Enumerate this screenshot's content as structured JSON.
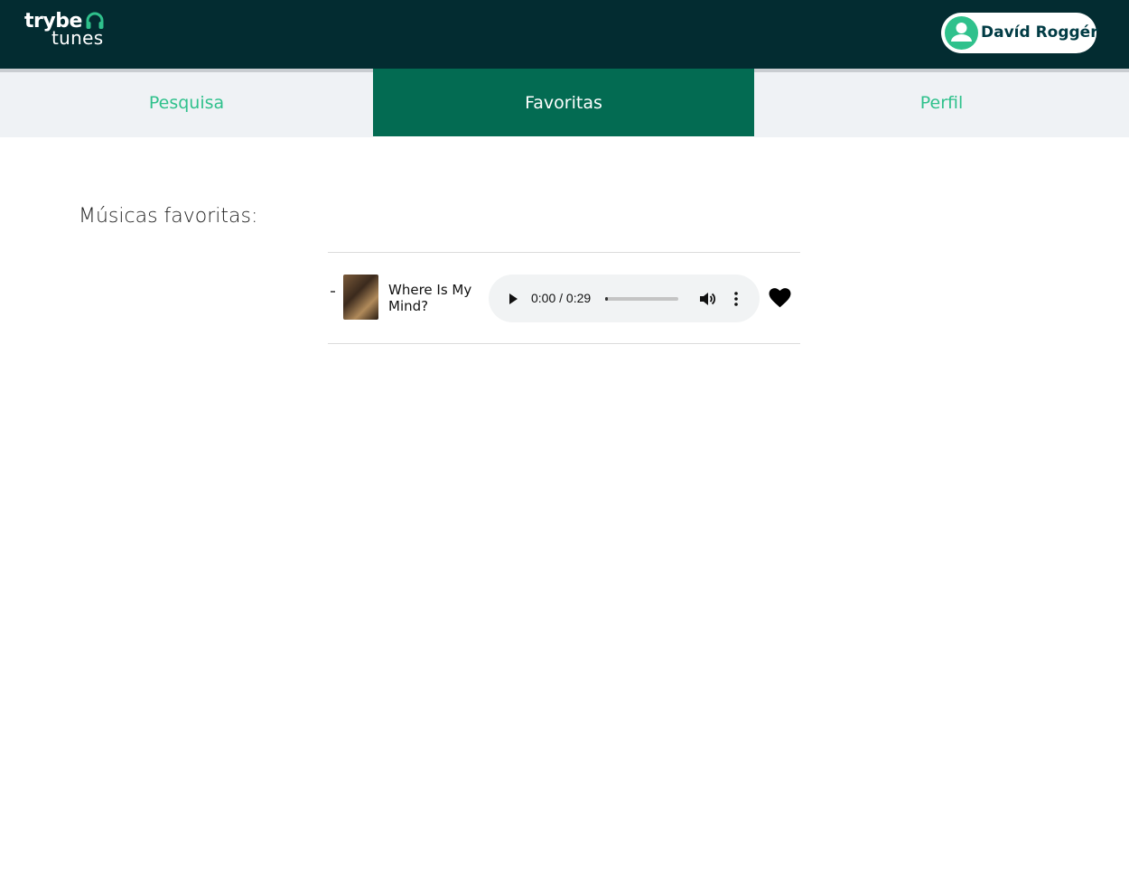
{
  "app": {
    "logo_top": "trybe",
    "logo_bottom": "tunes",
    "colors": {
      "header_bg": "#032c31",
      "accent": "#2fc18c",
      "active_tab": "#036b52"
    }
  },
  "header": {
    "user_name": "Davíd Roggér",
    "avatar_icon": "user-icon"
  },
  "nav": {
    "tabs": [
      {
        "label": "Pesquisa",
        "active": false
      },
      {
        "label": "Favoritas",
        "active": true
      },
      {
        "label": "Perfil",
        "active": false
      }
    ]
  },
  "main": {
    "title": "Músicas favoritas:",
    "songs": [
      {
        "name": "Where Is My Mind?",
        "player": {
          "time": "0:00 / 0:29",
          "progress": 0.0
        },
        "favorite": true
      }
    ]
  }
}
